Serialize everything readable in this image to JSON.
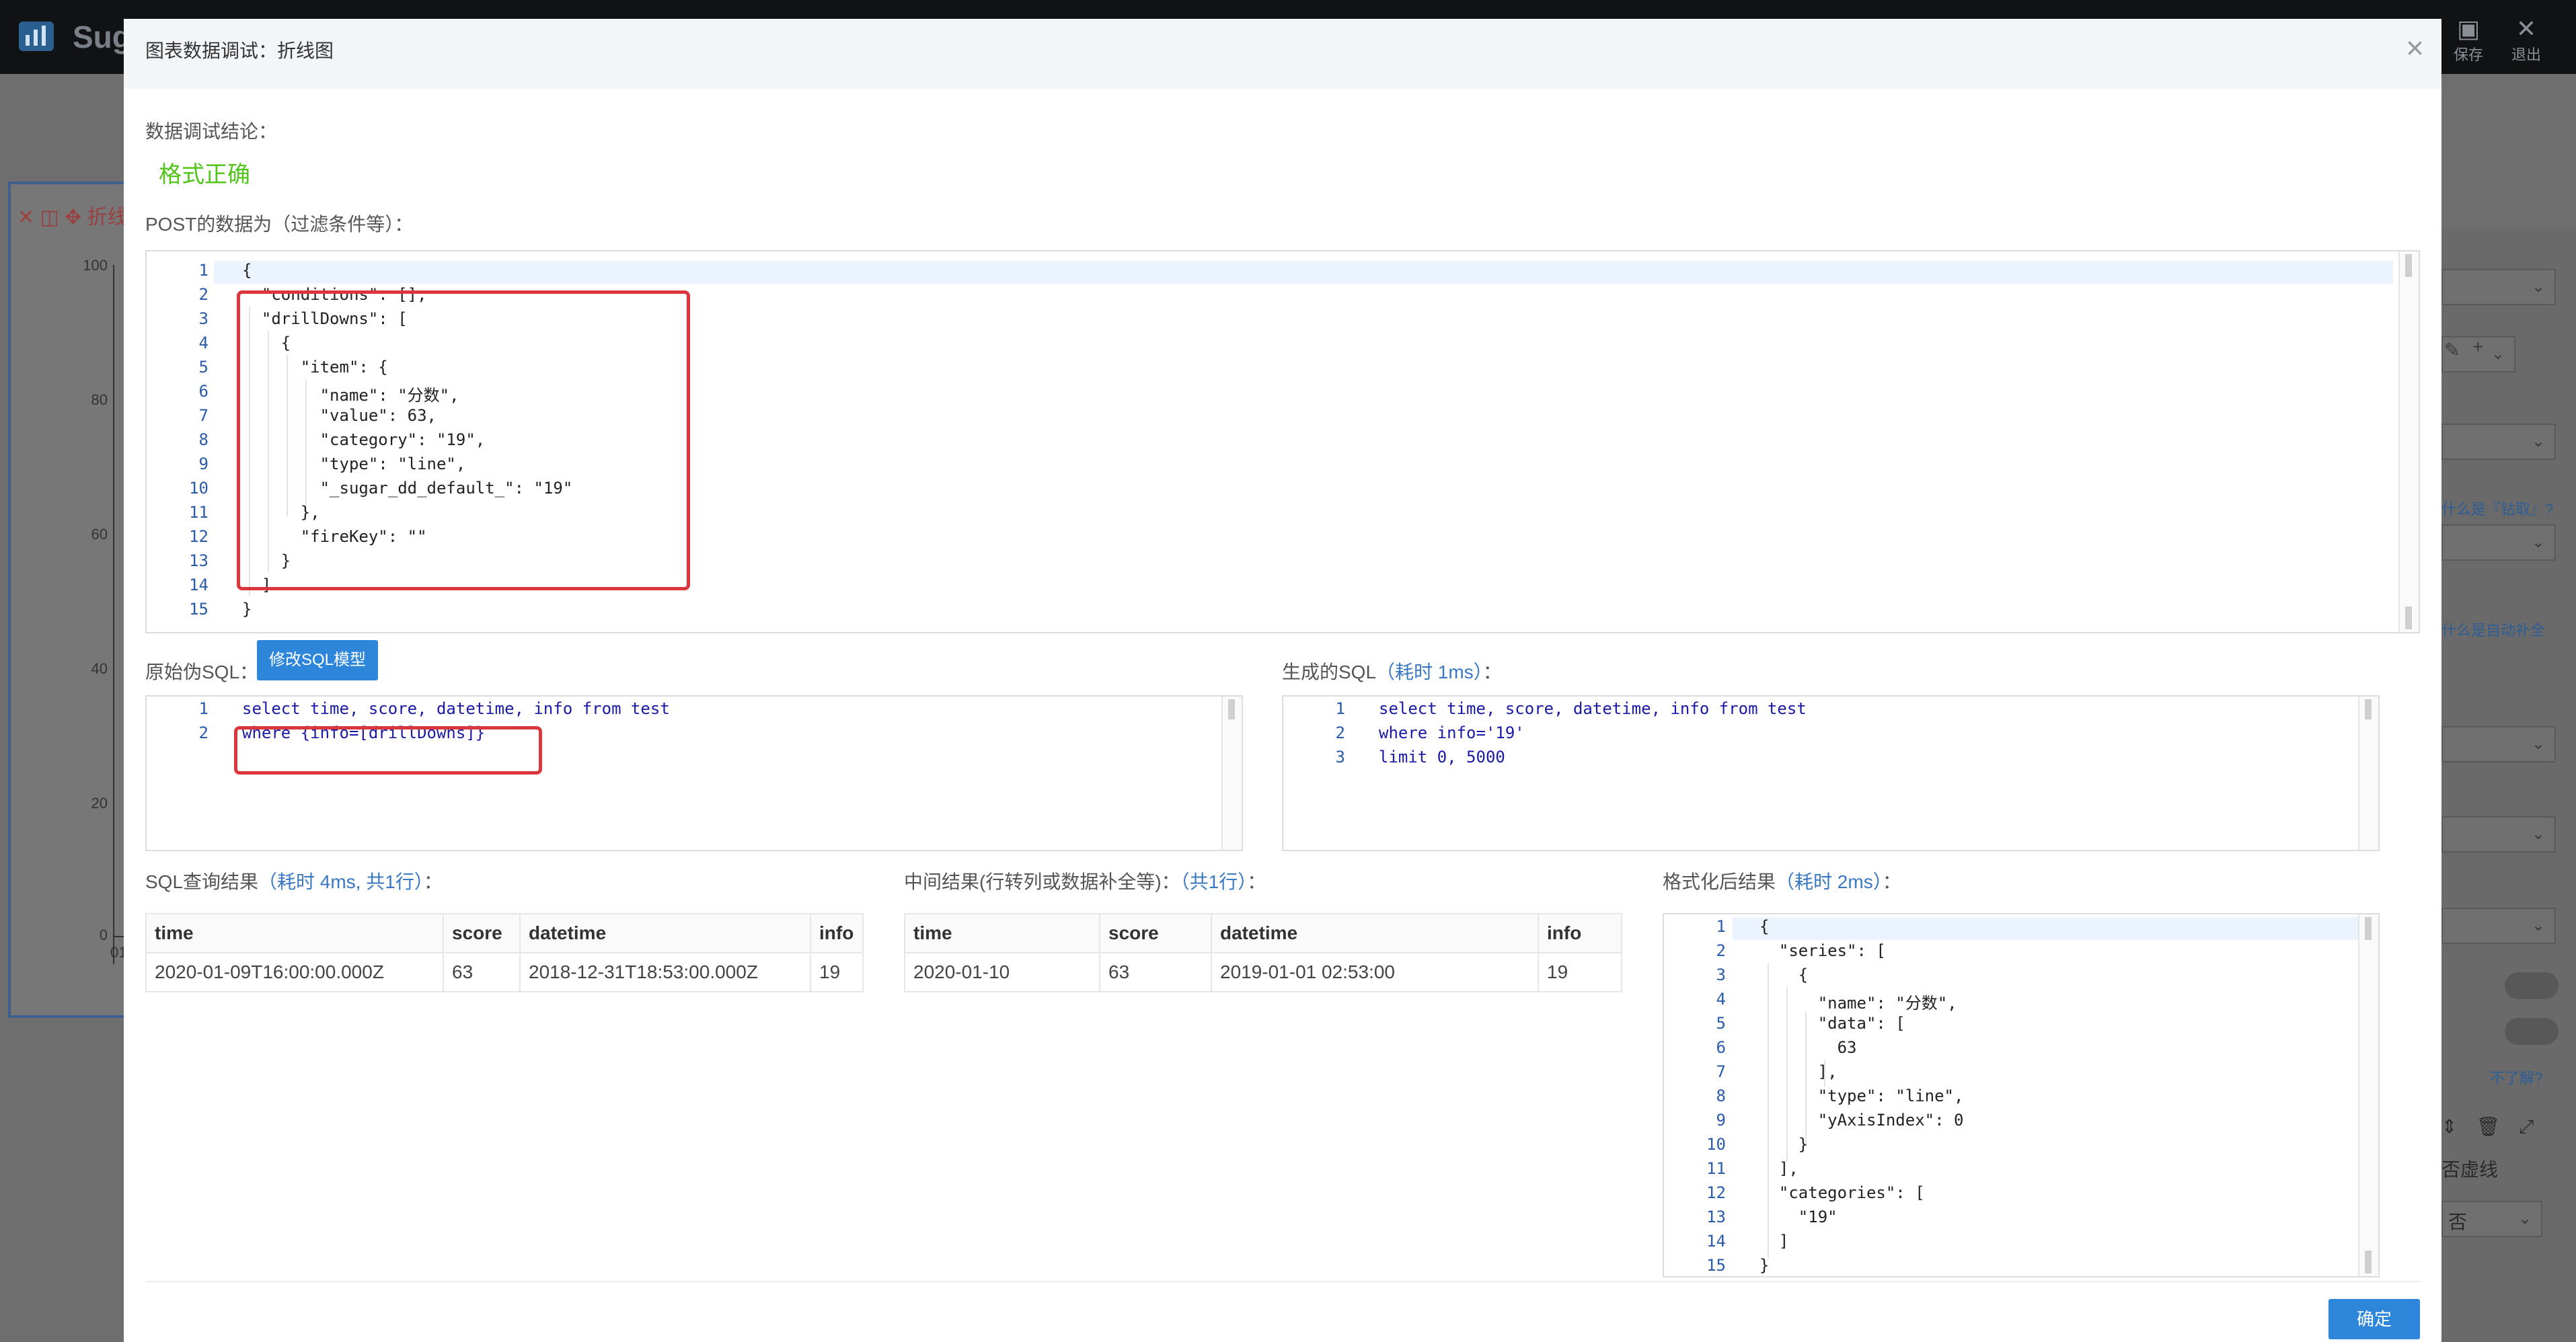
{
  "app": {
    "logo_text": "Sug",
    "save_label": "保存",
    "exit_label": "退出",
    "bg_chart_title": "折线",
    "bg_y_ticks": [
      "100",
      "80",
      "60",
      "40",
      "20",
      "0"
    ],
    "bg_x_tick": "01",
    "right_links": [
      "什么是『钻取』?",
      "什么是自动补全"
    ],
    "right_help": "不了解?",
    "right_dashed": "否虚线",
    "right_no": "否"
  },
  "modal": {
    "title": "图表数据调试：折线图",
    "close_label": "×",
    "conclusion_label": "数据调试结论：",
    "conclusion_value": "格式正确",
    "post_label": "POST的数据为（过滤条件等）：",
    "post_lines": [
      "{",
      "  \"conditions\": [],",
      "  \"drillDowns\": [",
      "    {",
      "      \"item\": {",
      "        \"name\": \"分数\",",
      "        \"value\": 63,",
      "        \"category\": \"19\",",
      "        \"type\": \"line\",",
      "        \"_sugar_dd_default_\": \"19\"",
      "      },",
      "      \"fireKey\": \"\"",
      "    }",
      "  ]",
      "}"
    ],
    "raw_sql_label": "原始伪SQL：",
    "modify_sql_button": "修改SQL模型",
    "raw_sql_lines": [
      "select time, score, datetime, info from test",
      "where {info=[drillDowns]}"
    ],
    "gen_sql_label": "生成的SQL",
    "gen_sql_time": "（耗时 1ms）",
    "gen_sql_colon": "：",
    "gen_sql_lines": [
      "select time, score, datetime, info from test",
      "where info='19'",
      "limit 0, 5000"
    ],
    "sql_result_label": "SQL查询结果",
    "sql_result_meta": "（耗时 4ms, 共1行）",
    "sql_result_colon": "：",
    "sql_result": {
      "headers": [
        "time",
        "score",
        "datetime",
        "info"
      ],
      "rows": [
        [
          "2020-01-09T16:00:00.000Z",
          "63",
          "2018-12-31T18:53:00.000Z",
          "19"
        ]
      ]
    },
    "mid_result_label": "中间结果(行转列或数据补全等)：",
    "mid_result_meta": "（共1行）",
    "mid_result_colon": "：",
    "mid_result": {
      "headers": [
        "time",
        "score",
        "datetime",
        "info"
      ],
      "rows": [
        [
          "2020-01-10",
          "63",
          "2019-01-01 02:53:00",
          "19"
        ]
      ]
    },
    "fmt_result_label": "格式化后结果",
    "fmt_result_meta": "（耗时 2ms）",
    "fmt_result_colon": "：",
    "fmt_lines": [
      "{",
      "  \"series\": [",
      "    {",
      "      \"name\": \"分数\",",
      "      \"data\": [",
      "        63",
      "      ],",
      "      \"type\": \"line\",",
      "      \"yAxisIndex\": 0",
      "    }",
      "  ],",
      "  \"categories\": [",
      "    \"19\"",
      "  ]",
      "}"
    ],
    "confirm_button": "确定"
  },
  "colors": {
    "accent": "#2d86d9",
    "success": "#52c41a",
    "highlight_box": "#d9363e"
  }
}
